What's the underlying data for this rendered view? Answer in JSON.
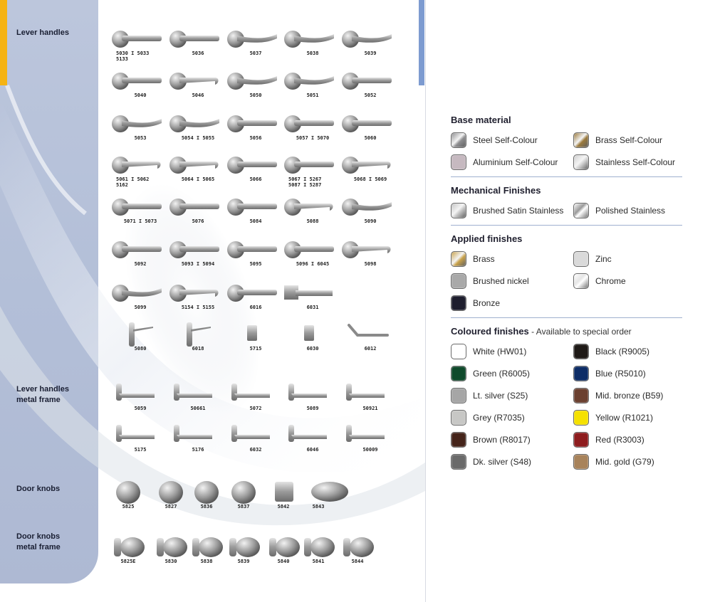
{
  "sections": {
    "lever_handles": [
      "Lever handles"
    ],
    "lever_metal": [
      "Lever handles",
      "metal frame"
    ],
    "door_knobs": [
      "Door knobs"
    ],
    "knobs_metal": [
      "Door knobs",
      "metal frame"
    ]
  },
  "products": [
    {
      "code": "5030 I 5033\n5133",
      "kind": "lever",
      "shape": "flat"
    },
    {
      "code": "5036",
      "kind": "lever",
      "shape": "flat"
    },
    {
      "code": "5037",
      "kind": "lever",
      "shape": "curve"
    },
    {
      "code": "5038",
      "kind": "lever",
      "shape": "curve"
    },
    {
      "code": "5039",
      "kind": "lever",
      "shape": "curve"
    },
    {
      "code": "5040",
      "kind": "lever",
      "shape": "straight"
    },
    {
      "code": "5046",
      "kind": "lever",
      "shape": "hook"
    },
    {
      "code": "5050",
      "kind": "lever",
      "shape": "curve"
    },
    {
      "code": "5051",
      "kind": "lever",
      "shape": "wave"
    },
    {
      "code": "5052",
      "kind": "lever",
      "shape": "flat"
    },
    {
      "code": "5053",
      "kind": "lever",
      "shape": "wave"
    },
    {
      "code": "5054 I 5055",
      "kind": "lever",
      "shape": "curve"
    },
    {
      "code": "5056",
      "kind": "lever",
      "shape": "straight"
    },
    {
      "code": "5057 I 5070",
      "kind": "lever",
      "shape": "straight"
    },
    {
      "code": "5060",
      "kind": "lever",
      "shape": "straight"
    },
    {
      "code": "5061 I 5062\n5162",
      "kind": "lever",
      "shape": "hook"
    },
    {
      "code": "5064 I 5065",
      "kind": "lever",
      "shape": "hook"
    },
    {
      "code": "5066",
      "kind": "lever",
      "shape": "straight"
    },
    {
      "code": "5067 I 5267\n5087 I 5287",
      "kind": "lever",
      "shape": "straight"
    },
    {
      "code": "5068 I 5069",
      "kind": "lever",
      "shape": "hook"
    },
    {
      "code": "5071 I 5073",
      "kind": "lever",
      "shape": "straight"
    },
    {
      "code": "5076",
      "kind": "lever",
      "shape": "flat"
    },
    {
      "code": "5084",
      "kind": "lever",
      "shape": "straight"
    },
    {
      "code": "5088",
      "kind": "lever",
      "shape": "hook"
    },
    {
      "code": "5090",
      "kind": "lever",
      "shape": "wave"
    },
    {
      "code": "5092",
      "kind": "lever",
      "shape": "straight"
    },
    {
      "code": "5093 I 5094",
      "kind": "lever",
      "shape": "straight"
    },
    {
      "code": "5095",
      "kind": "lever",
      "shape": "straight"
    },
    {
      "code": "5096 I 6045",
      "kind": "lever",
      "shape": "straight"
    },
    {
      "code": "5098",
      "kind": "lever",
      "shape": "hook"
    },
    {
      "code": "5099",
      "kind": "lever",
      "shape": "curve"
    },
    {
      "code": "5154 I 5155",
      "kind": "lever",
      "shape": "hook"
    },
    {
      "code": "6016",
      "kind": "lever",
      "shape": "straight"
    },
    {
      "code": "6031",
      "kind": "lever",
      "shape": "square"
    },
    {
      "code": "5080",
      "kind": "plate",
      "shape": "plate"
    },
    {
      "code": "6018",
      "kind": "plate",
      "shape": "plate"
    },
    {
      "code": "5715",
      "kind": "pull",
      "shape": "pull"
    },
    {
      "code": "6030",
      "kind": "pull",
      "shape": "pull"
    },
    {
      "code": "6012",
      "kind": "pull",
      "shape": "bent"
    },
    {
      "code": "5059",
      "kind": "frame",
      "shape": "frame"
    },
    {
      "code": "50661",
      "kind": "frame",
      "shape": "frame"
    },
    {
      "code": "5072",
      "kind": "frame",
      "shape": "frame"
    },
    {
      "code": "5089",
      "kind": "frame",
      "shape": "frame"
    },
    {
      "code": "50921",
      "kind": "frame",
      "shape": "frame"
    },
    {
      "code": "5175",
      "kind": "frame",
      "shape": "frame"
    },
    {
      "code": "5176",
      "kind": "frame",
      "shape": "frame"
    },
    {
      "code": "6032",
      "kind": "frame",
      "shape": "frame"
    },
    {
      "code": "6046",
      "kind": "frame",
      "shape": "frame"
    },
    {
      "code": "50009",
      "kind": "frame",
      "shape": "frame"
    },
    {
      "code": "5825",
      "kind": "knob",
      "shape": "knob"
    },
    {
      "code": "5827",
      "kind": "knob",
      "shape": "knob"
    },
    {
      "code": "5836",
      "kind": "knob",
      "shape": "knob"
    },
    {
      "code": "5837",
      "kind": "knob",
      "shape": "knob"
    },
    {
      "code": "5842",
      "kind": "knob",
      "shape": "square"
    },
    {
      "code": "5843",
      "kind": "knob",
      "shape": "oval"
    },
    {
      "code": "5825E",
      "kind": "knob",
      "shape": "frameknob"
    },
    {
      "code": "5830",
      "kind": "knob",
      "shape": "frameknob"
    },
    {
      "code": "5838",
      "kind": "knob",
      "shape": "frameknob"
    },
    {
      "code": "5839",
      "kind": "knob",
      "shape": "frameknob"
    },
    {
      "code": "5840",
      "kind": "knob",
      "shape": "frameknob"
    },
    {
      "code": "5841",
      "kind": "knob",
      "shape": "frameknob"
    },
    {
      "code": "5844",
      "kind": "knob",
      "shape": "frameknob"
    }
  ],
  "legend": {
    "base": {
      "title": "Base material",
      "items": [
        {
          "label": "Steel Self-Colour",
          "color": "#8e8e90",
          "style": "metal"
        },
        {
          "label": "Brass Self-Colour",
          "color": "#9b7a3c",
          "style": "metal"
        },
        {
          "label": "Aluminium Self-Colour",
          "color": "#c6b9c0",
          "style": "flat"
        },
        {
          "label": "Stainless Self-Colour",
          "color": "#cfcfcf",
          "style": "metal"
        }
      ]
    },
    "mechanical": {
      "title": "Mechanical Finishes",
      "items": [
        {
          "label": "Brushed Satin Stainless",
          "color": "#c5c5c5",
          "style": "metal"
        },
        {
          "label": "Polished Stainless",
          "color": "#9a9a9a",
          "style": "shine"
        }
      ]
    },
    "applied": {
      "title": "Applied finishes",
      "items": [
        {
          "label": "Brass",
          "color": "#c9a24b",
          "style": "metal"
        },
        {
          "label": "Zinc",
          "color": "#dadada",
          "style": "flat"
        },
        {
          "label": "Brushed nickel",
          "color": "#a9a9a9",
          "style": "flat"
        },
        {
          "label": "Chrome",
          "color": "#e6e6e6",
          "style": "shine"
        },
        {
          "label": "Bronze",
          "color": "#1e1e2e",
          "style": "flat"
        }
      ]
    },
    "coloured": {
      "title": "Coloured finishes",
      "note": " - Available to special order",
      "items": [
        {
          "label": "White (HW01)",
          "color": "#ffffff"
        },
        {
          "label": "Black (R9005)",
          "color": "#1f1a17"
        },
        {
          "label": "Green (R6005)",
          "color": "#0f4a2b"
        },
        {
          "label": "Blue (R5010)",
          "color": "#0d2c66"
        },
        {
          "label": "Lt. silver (S25)",
          "color": "#a6a6a6"
        },
        {
          "label": "Mid. bronze (B59)",
          "color": "#6b4030"
        },
        {
          "label": "Grey (R7035)",
          "color": "#c7c7c5"
        },
        {
          "label": "Yellow (R1021)",
          "color": "#f5e100"
        },
        {
          "label": "Brown (R8017)",
          "color": "#45241a"
        },
        {
          "label": "Red (R3003)",
          "color": "#8e1d1f"
        },
        {
          "label": "Dk. silver (S48)",
          "color": "#6a6a6a"
        },
        {
          "label": "Mid. gold (G79)",
          "color": "#a8835b"
        }
      ]
    }
  }
}
